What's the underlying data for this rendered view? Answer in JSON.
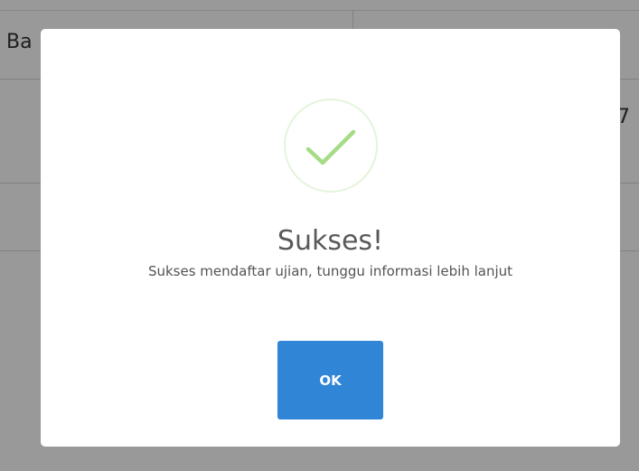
{
  "background": {
    "header_text": "Ba",
    "cell_text": "7"
  },
  "modal": {
    "icon": "check-circle-icon",
    "title": "Sukses!",
    "message": "Sukses mendaftar ujian, tunggu informasi lebih lanjut",
    "ok_label": "OK"
  },
  "colors": {
    "overlay": "rgba(0,0,0,0.40)",
    "success": "#a5dc86",
    "success_ring": "rgba(165,220,134,0.3)",
    "button": "#3085d6",
    "title": "#595959",
    "message": "#545454"
  }
}
